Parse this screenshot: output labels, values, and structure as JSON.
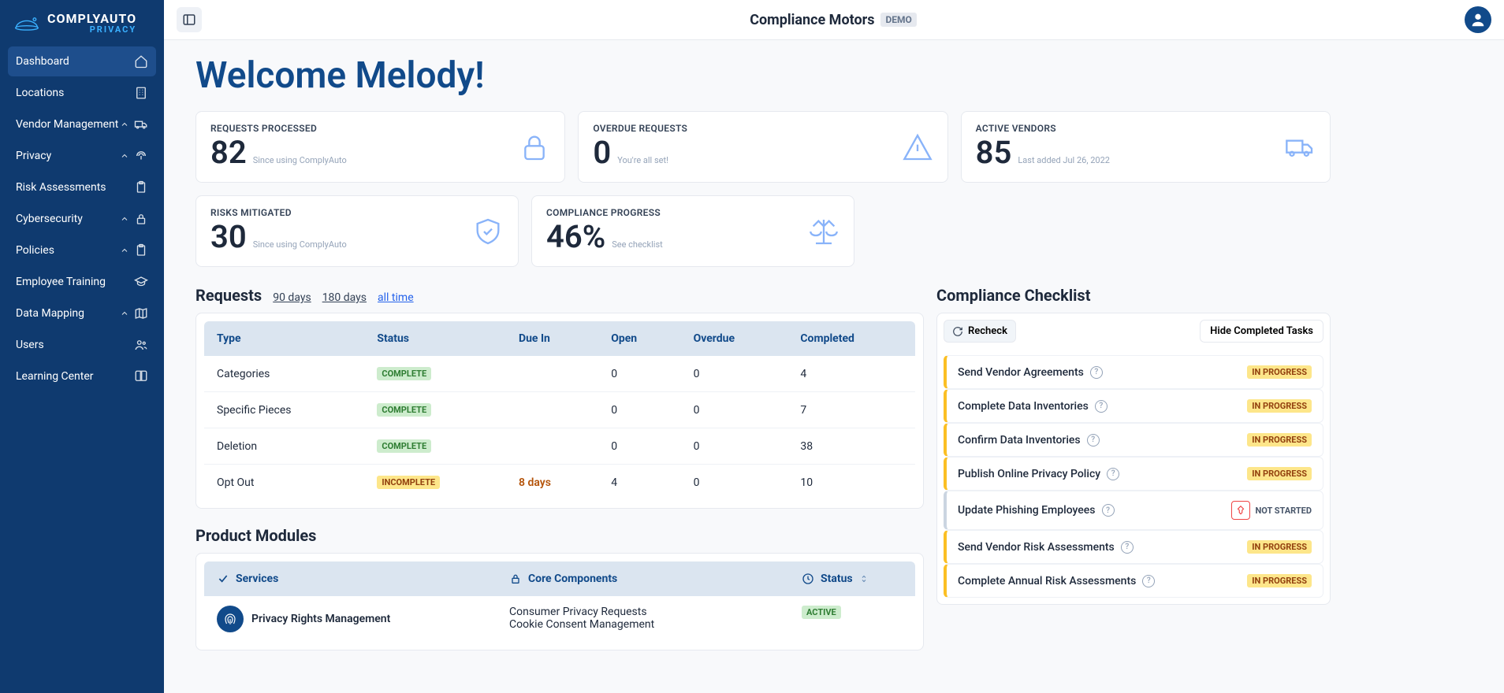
{
  "brand": {
    "main": "COMPLYAUTO",
    "sub": "PRIVACY"
  },
  "org": {
    "name": "Compliance Motors",
    "badge": "DEMO"
  },
  "sidebar": {
    "items": [
      {
        "label": "Dashboard",
        "active": true,
        "expandable": false
      },
      {
        "label": "Locations",
        "expandable": false
      },
      {
        "label": "Vendor Management",
        "expandable": true
      },
      {
        "label": "Privacy",
        "expandable": true
      },
      {
        "label": "Risk Assessments",
        "expandable": false
      },
      {
        "label": "Cybersecurity",
        "expandable": true
      },
      {
        "label": "Policies",
        "expandable": true
      },
      {
        "label": "Employee Training",
        "expandable": false
      },
      {
        "label": "Data Mapping",
        "expandable": true
      },
      {
        "label": "Users",
        "expandable": false
      },
      {
        "label": "Learning Center",
        "expandable": false
      }
    ]
  },
  "welcome": "Welcome Melody!",
  "stats": {
    "requests_processed": {
      "label": "REQUESTS PROCESSED",
      "value": "82",
      "sub": "Since using ComplyAuto"
    },
    "overdue_requests": {
      "label": "OVERDUE REQUESTS",
      "value": "0",
      "sub": "You're all set!"
    },
    "active_vendors": {
      "label": "ACTIVE VENDORS",
      "value": "85",
      "sub": "Last added Jul 26, 2022"
    },
    "risks_mitigated": {
      "label": "RISKS MITIGATED",
      "value": "30",
      "sub": "Since using ComplyAuto"
    },
    "compliance_progress": {
      "label": "COMPLIANCE PROGRESS",
      "value": "46%",
      "sub": "See checklist"
    }
  },
  "requests": {
    "title": "Requests",
    "ranges": {
      "d90": "90 days",
      "d180": "180 days",
      "all": "all time"
    },
    "columns": {
      "type": "Type",
      "status": "Status",
      "due": "Due In",
      "open": "Open",
      "overdue": "Overdue",
      "completed": "Completed"
    },
    "rows": [
      {
        "type": "Categories",
        "status": "COMPLETE",
        "status_kind": "complete",
        "due": "",
        "open": "0",
        "overdue": "0",
        "completed": "4"
      },
      {
        "type": "Specific Pieces",
        "status": "COMPLETE",
        "status_kind": "complete",
        "due": "",
        "open": "0",
        "overdue": "0",
        "completed": "7"
      },
      {
        "type": "Deletion",
        "status": "COMPLETE",
        "status_kind": "complete",
        "due": "",
        "open": "0",
        "overdue": "0",
        "completed": "38"
      },
      {
        "type": "Opt Out",
        "status": "INCOMPLETE",
        "status_kind": "incomplete",
        "due": "8 days",
        "open": "4",
        "overdue": "0",
        "completed": "10"
      }
    ]
  },
  "checklist": {
    "title": "Compliance Checklist",
    "recheck": "Recheck",
    "hide": "Hide Completed Tasks",
    "items": [
      {
        "label": "Send Vendor Agreements",
        "status": "IN PROGRESS",
        "kind": "inprogress"
      },
      {
        "label": "Complete Data Inventories",
        "status": "IN PROGRESS",
        "kind": "inprogress"
      },
      {
        "label": "Confirm Data Inventories",
        "status": "IN PROGRESS",
        "kind": "inprogress"
      },
      {
        "label": "Publish Online Privacy Policy",
        "status": "IN PROGRESS",
        "kind": "inprogress"
      },
      {
        "label": "Update Phishing Employees",
        "status": "NOT STARTED",
        "kind": "notstarted"
      },
      {
        "label": "Send Vendor Risk Assessments",
        "status": "IN PROGRESS",
        "kind": "inprogress"
      },
      {
        "label": "Complete Annual Risk Assessments",
        "status": "IN PROGRESS",
        "kind": "inprogress"
      }
    ]
  },
  "modules": {
    "title": "Product Modules",
    "columns": {
      "services": "Services",
      "core": "Core Components",
      "status": "Status"
    },
    "rows": [
      {
        "service": "Privacy Rights Management",
        "components": [
          "Consumer Privacy Requests",
          "Cookie Consent Management"
        ],
        "status": "ACTIVE"
      }
    ]
  }
}
